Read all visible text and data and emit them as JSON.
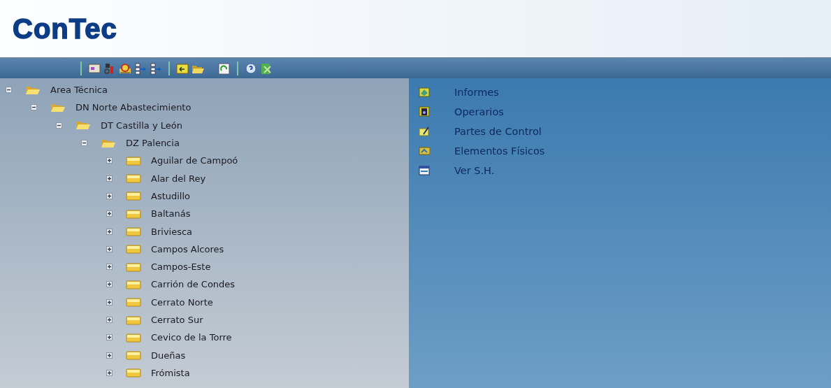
{
  "header": {
    "logo": "ConTec"
  },
  "tree": [
    {
      "label": "Area Técnica",
      "expanded": true,
      "children": [
        {
          "label": "DN Norte Abastecimiento",
          "expanded": true,
          "children": [
            {
              "label": "DT Castilla y León",
              "expanded": true,
              "children": [
                {
                  "label": "DZ Palencia",
                  "expanded": true,
                  "children": [
                    {
                      "label": "Aguilar de Campoó",
                      "expanded": false
                    },
                    {
                      "label": "Alar del Rey",
                      "expanded": false
                    },
                    {
                      "label": "Astudillo",
                      "expanded": false
                    },
                    {
                      "label": "Baltanás",
                      "expanded": false
                    },
                    {
                      "label": "Briviesca",
                      "expanded": false
                    },
                    {
                      "label": "Campos Alcores",
                      "expanded": false
                    },
                    {
                      "label": "Campos-Este",
                      "expanded": false
                    },
                    {
                      "label": "Carrión de Condes",
                      "expanded": false
                    },
                    {
                      "label": "Cerrato Norte",
                      "expanded": false
                    },
                    {
                      "label": "Cerrato Sur",
                      "expanded": false
                    },
                    {
                      "label": "Cevico de la Torre",
                      "expanded": false
                    },
                    {
                      "label": "Dueñas",
                      "expanded": false
                    },
                    {
                      "label": "Frómista",
                      "expanded": false
                    }
                  ]
                }
              ]
            }
          ]
        }
      ]
    }
  ],
  "menu": [
    {
      "label": "Informes"
    },
    {
      "label": "Operarios"
    },
    {
      "label": "Partes de Control"
    },
    {
      "label": "Elementos Físicos"
    },
    {
      "label": "Ver S.H."
    }
  ]
}
